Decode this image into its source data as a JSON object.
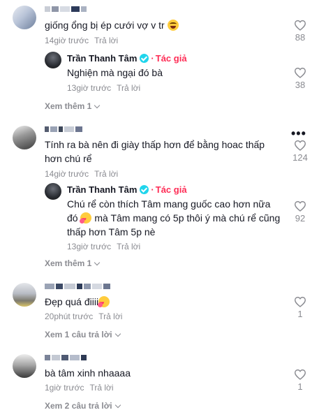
{
  "colors": {
    "accent": "#fe2c55",
    "text": "#161823",
    "muted": "#8a8b91",
    "verified": "#20d5ec"
  },
  "comments": [
    {
      "text": "giống ổng bị ép cưới vợ v tr",
      "emoji": "laughing-face",
      "time": "14giờ trước",
      "reply": "Trả lời",
      "likes": "88",
      "replies": [
        {
          "author": "Trần Thanh Tâm",
          "author_tag": "Tác giả",
          "text": "Nghiện mà ngại đó bà",
          "time": "13giờ trước",
          "reply": "Trả lời",
          "likes": "38"
        }
      ],
      "more": "Xem thêm 1"
    },
    {
      "text": "Tính ra bà nên đi giày thấp hơn để bằng hoac thấp hơn chú rể",
      "time": "14giờ trước",
      "reply": "Trả lời",
      "likes": "124",
      "replies": [
        {
          "author": "Trần Thanh Tâm",
          "author_tag": "Tác giả",
          "text_a": "Chú rể còn thích Tâm mang guốc cao hơn nữa đó",
          "text_b": "mà Tâm mang có 5p thôi ý mà chú rể cũng thấp hơn Tâm 5p nè",
          "emoji": "smiling-face-with-hearts",
          "time": "13giờ trước",
          "reply": "Trả lời",
          "likes": "92"
        }
      ],
      "more": "Xem thêm 1"
    },
    {
      "text": "Đẹp quá điiii",
      "emoji": "smiling-face-with-hearts",
      "time": "20phút trước",
      "reply": "Trả lời",
      "likes": "1",
      "more": "Xem 1 câu trả lời"
    },
    {
      "text": "bà tâm xinh nhaaaa",
      "time": "1giờ trước",
      "reply": "Trả lời",
      "likes": "1",
      "more": "Xem 2 câu trả lời"
    }
  ]
}
